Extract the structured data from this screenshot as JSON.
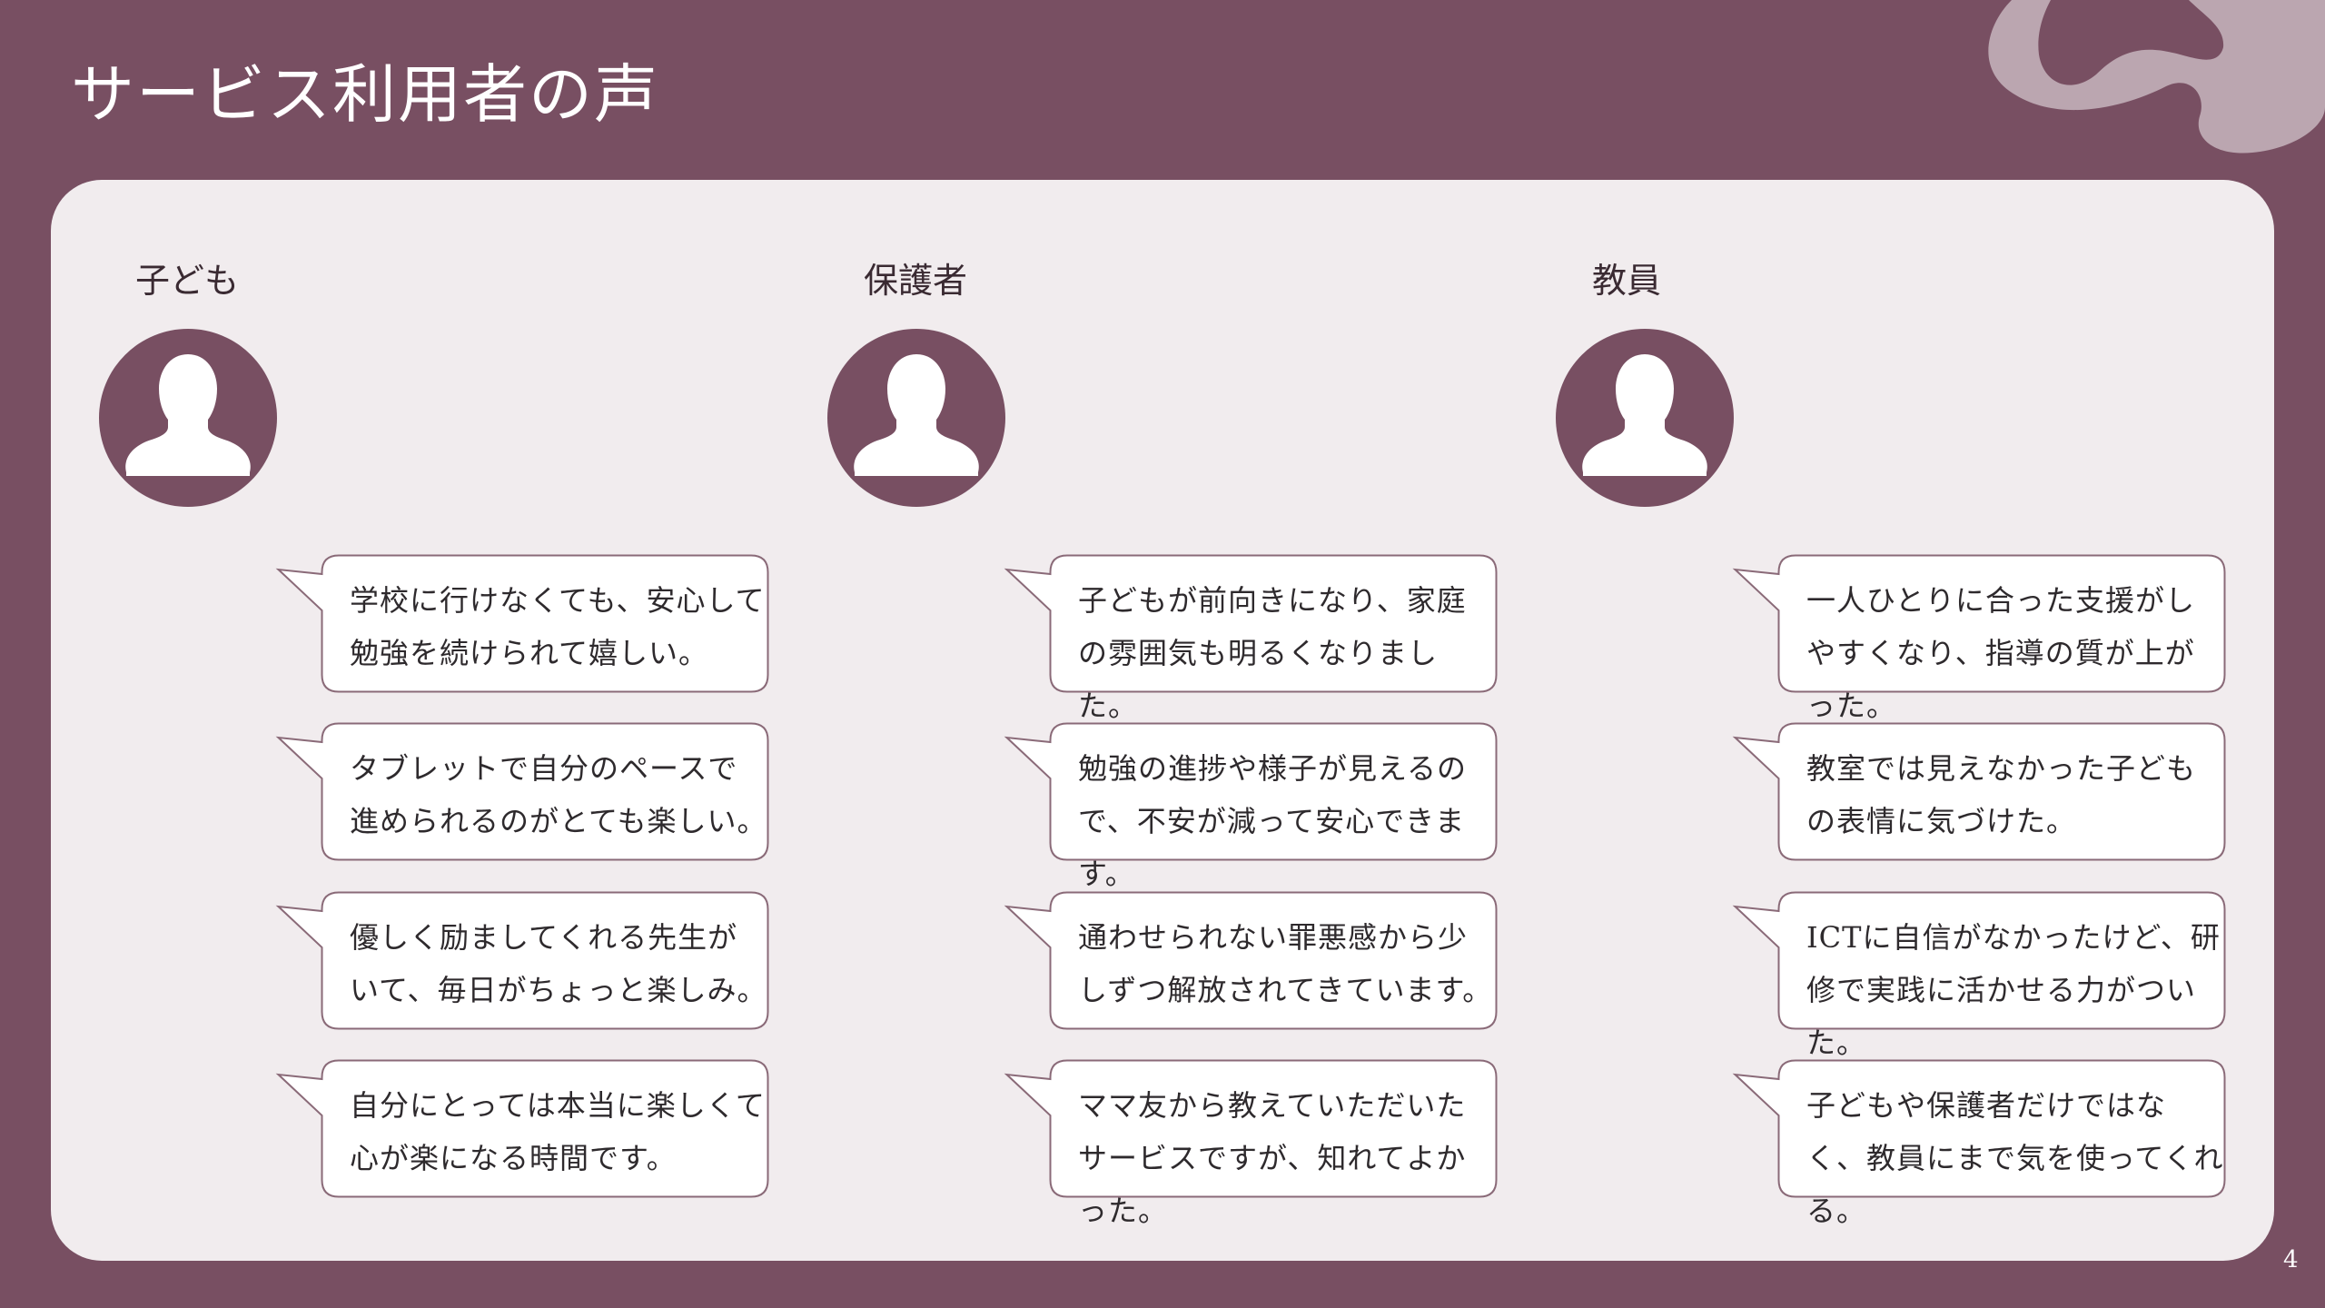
{
  "slide": {
    "title": "サービス利用者の声",
    "page_number": "4"
  },
  "colors": {
    "background": "#784F62",
    "panel": "#F1ECEE",
    "accent": "#784F62",
    "bubble_border": "#8A6A78",
    "blob": "#BBA6B0"
  },
  "groups": [
    {
      "label": "子ども",
      "icon": "person-icon",
      "comments": [
        "学校に行けなくても、安心して勉強を続けられて嬉しい。",
        "タブレットで自分のペースで進められるのがとても楽しい。",
        "優しく励ましてくれる先生がいて、毎日がちょっと楽しみ。",
        "自分にとっては本当に楽しくて心が楽になる時間です。"
      ]
    },
    {
      "label": "保護者",
      "icon": "person-icon",
      "comments": [
        "子どもが前向きになり、家庭の雰囲気も明るくなりました。",
        "勉強の進捗や様子が見えるので、不安が減って安心できます。",
        "通わせられない罪悪感から少しずつ解放されてきています。",
        "ママ友から教えていただいたサービスですが、知れてよかった。"
      ]
    },
    {
      "label": "教員",
      "icon": "person-icon",
      "comments": [
        "一人ひとりに合った支援がしやすくなり、指導の質が上がった。",
        "教室では見えなかった子どもの表情に気づけた。",
        "ICTに自信がなかったけど、研修で実践に活かせる力がついた。",
        "子どもや保護者だけではなく、教員にまで気を使ってくれる。"
      ]
    }
  ]
}
